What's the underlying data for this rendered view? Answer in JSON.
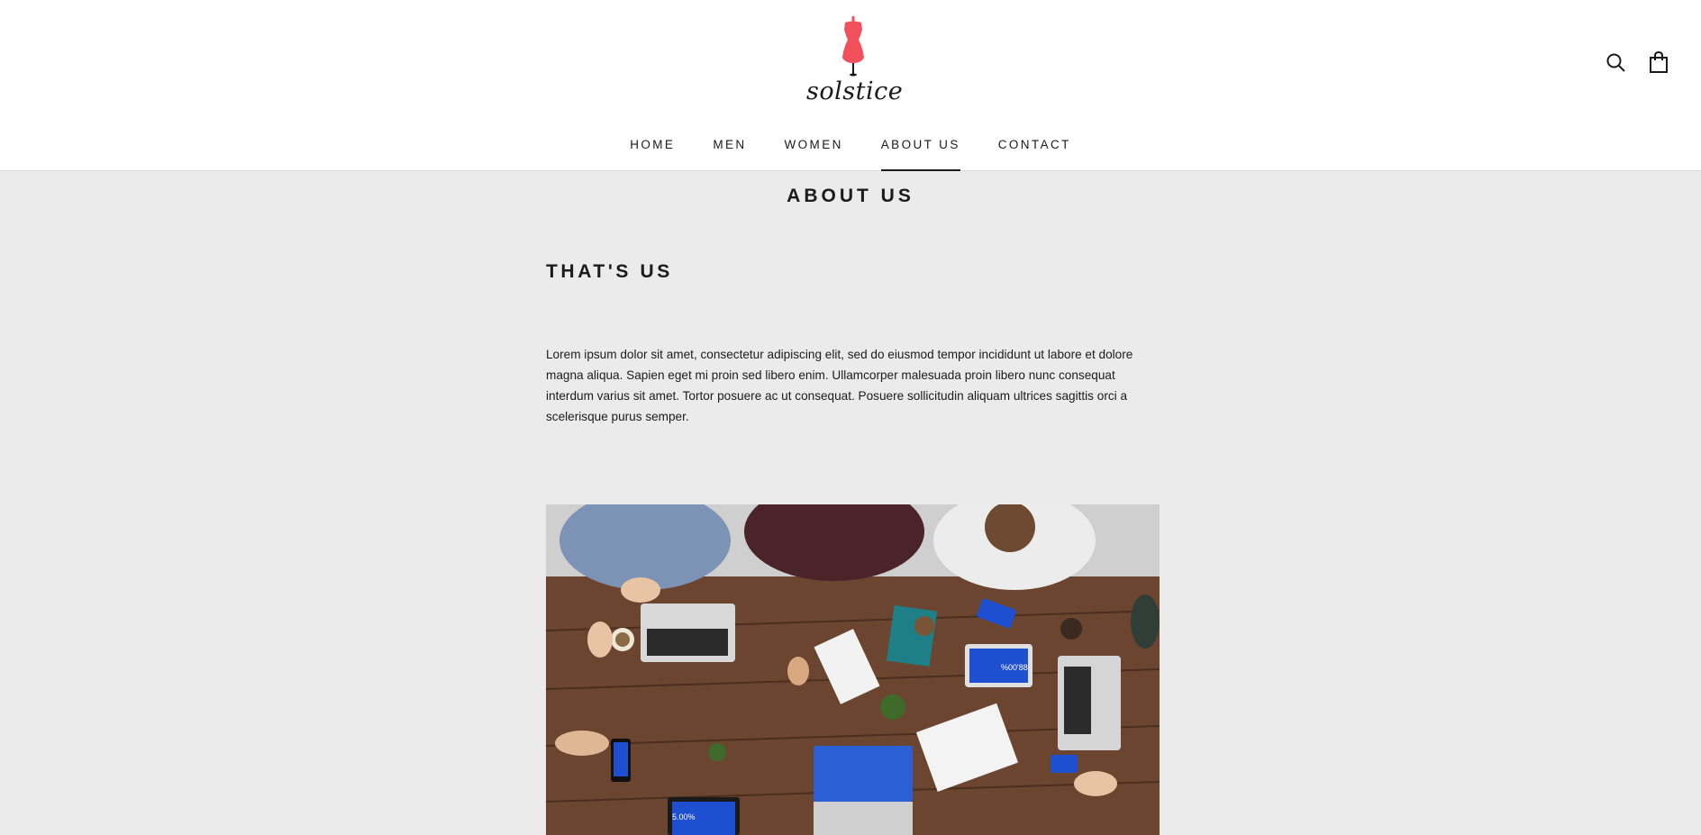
{
  "brand": {
    "logo_text": "solstice",
    "accent": "#f2505a"
  },
  "header": {
    "icons": [
      "search-icon",
      "shopping-bag-icon"
    ]
  },
  "nav": {
    "items": [
      {
        "label": "HOME",
        "active": false
      },
      {
        "label": "MEN",
        "active": false
      },
      {
        "label": "WOMEN",
        "active": false
      },
      {
        "label": "ABOUT US",
        "active": true
      },
      {
        "label": "CONTACT",
        "active": false
      }
    ]
  },
  "page": {
    "title": "ABOUT US",
    "section_title": "THAT'S US",
    "body": "Lorem ipsum dolor sit amet, consectetur adipiscing elit, sed do eiusmod tempor incididunt ut labore et dolore magna aliqua. Sapien eget mi proin sed libero enim. Ullamcorper malesuada proin libero nunc consequat interdum varius sit amet. Tortor posuere ac ut consequat. Posuere sollicitudin aliquam ultrices sagittis orci a scelerisque purus semper.",
    "photo_labels": {
      "tablet_stat": "%00'88",
      "tablet_stat_2": "5.00%"
    }
  },
  "colors": {
    "header_bg": "#ffffff",
    "page_bg": "#ebebeb",
    "text": "#1c1b1b"
  }
}
